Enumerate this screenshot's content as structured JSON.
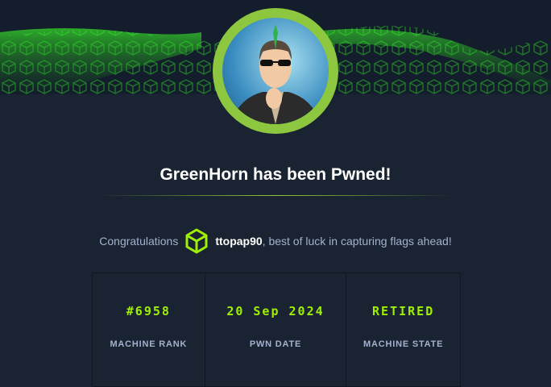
{
  "header": {
    "title": "GreenHorn has been Pwned!"
  },
  "congrats": {
    "prefix": "Congratulations",
    "username": "ttopap90",
    "suffix": ", best of luck in capturing flags ahead!",
    "icon": "htb-cube-icon"
  },
  "stats": [
    {
      "value": "#6958",
      "label": "MACHINE RANK"
    },
    {
      "value": "20 Sep 2024",
      "label": "PWN DATE"
    },
    {
      "value": "RETIRED",
      "label": "MACHINE STATE"
    }
  ],
  "colors": {
    "accent": "#9fef00",
    "background": "#1a2332",
    "avatar_ring": "#8dc63f"
  }
}
